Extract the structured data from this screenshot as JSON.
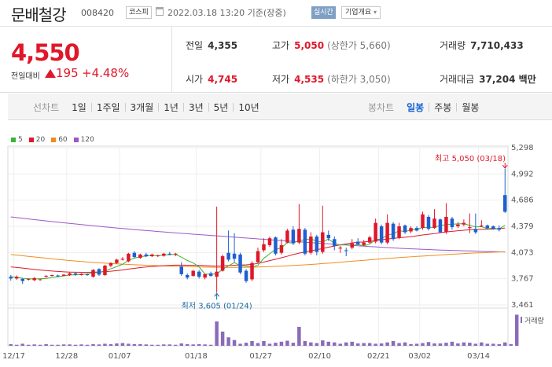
{
  "header": {
    "stock_name": "문배철강",
    "stock_code": "008420",
    "market": "코스피",
    "datetime": "2022.03.18 13:20 기준(장중)",
    "live_label": "실시간",
    "corp_label": "기업개요"
  },
  "price": {
    "current": "4,550",
    "change_label": "전일대비",
    "change": "195",
    "change_pct": "+4.48%"
  },
  "stats": {
    "prev_close_label": "전일",
    "prev_close": "4,355",
    "open_label": "시가",
    "open": "4,745",
    "high_label": "고가",
    "high": "5,050",
    "high_limit": "(상한가 5,660)",
    "low_label": "저가",
    "low": "4,535",
    "low_limit": "(하한가 3,050)",
    "volume_label": "거래량",
    "volume": "7,710,433",
    "amount_label": "거래대금",
    "amount": "37,204 백만"
  },
  "tabs": {
    "line_label": "선차트",
    "line_periods": [
      "1일",
      "1주일",
      "3개월",
      "1년",
      "3년",
      "5년",
      "10년"
    ],
    "candle_label": "봉차트",
    "candle_periods": [
      "일봉",
      "주봉",
      "월봉"
    ],
    "active_candle": "일봉"
  },
  "colors": {
    "up": "#e0172a",
    "down": "#1f5fd1",
    "ma5": "#3cb435",
    "ma20": "#e0172a",
    "ma60": "#f08c1e",
    "ma120": "#9b59c7",
    "volume": "#8a6bb8"
  },
  "chart_data": {
    "type": "candlestick",
    "y_ticks": [
      "5,298",
      "4,992",
      "4,686",
      "4,379",
      "4,073",
      "3,767",
      "3,461"
    ],
    "ylim": [
      3461,
      5298
    ],
    "x_ticks": [
      "12/17",
      "12/28",
      "01/07",
      "01/18",
      "01/27",
      "02/10",
      "02/21",
      "03/02",
      "03/14"
    ],
    "legend": [
      "5",
      "20",
      "60",
      "120"
    ],
    "high_annotation": "최고 5,050 (03/18)",
    "low_annotation": "최저 3,605 (01/24)",
    "volume_label": "거래량",
    "candles": [
      {
        "o": 3790,
        "c": 3770,
        "h": 3810,
        "l": 3745
      },
      {
        "o": 3770,
        "c": 3790,
        "h": 3805,
        "l": 3755
      },
      {
        "o": 3765,
        "c": 3740,
        "h": 3775,
        "l": 3705
      },
      {
        "o": 3760,
        "c": 3765,
        "h": 3770,
        "l": 3745
      },
      {
        "o": 3750,
        "c": 3775,
        "h": 3785,
        "l": 3740
      },
      {
        "o": 3755,
        "c": 3760,
        "h": 3765,
        "l": 3745
      },
      {
        "o": 3790,
        "c": 3800,
        "h": 3810,
        "l": 3780
      },
      {
        "o": 3800,
        "c": 3810,
        "h": 3815,
        "l": 3795
      },
      {
        "o": 3805,
        "c": 3795,
        "h": 3815,
        "l": 3785
      },
      {
        "o": 3800,
        "c": 3815,
        "h": 3820,
        "l": 3795
      },
      {
        "o": 3810,
        "c": 3830,
        "h": 3840,
        "l": 3800
      },
      {
        "o": 3830,
        "c": 3815,
        "h": 3840,
        "l": 3800
      },
      {
        "o": 3810,
        "c": 3825,
        "h": 3830,
        "l": 3805
      },
      {
        "o": 3820,
        "c": 3810,
        "h": 3830,
        "l": 3800
      },
      {
        "o": 3790,
        "c": 3870,
        "h": 3880,
        "l": 3780
      },
      {
        "o": 3880,
        "c": 3815,
        "h": 3890,
        "l": 3800
      },
      {
        "o": 3810,
        "c": 3920,
        "h": 3930,
        "l": 3800
      },
      {
        "o": 3920,
        "c": 3950,
        "h": 3960,
        "l": 3900
      },
      {
        "o": 3950,
        "c": 3990,
        "h": 4000,
        "l": 3940
      },
      {
        "o": 3990,
        "c": 4000,
        "h": 4020,
        "l": 3980
      },
      {
        "o": 3970,
        "c": 4060,
        "h": 4070,
        "l": 3960
      },
      {
        "o": 4070,
        "c": 4020,
        "h": 4090,
        "l": 4010
      },
      {
        "o": 4010,
        "c": 4050,
        "h": 4060,
        "l": 4000
      },
      {
        "o": 4050,
        "c": 4030,
        "h": 4070,
        "l": 4020
      },
      {
        "o": 4030,
        "c": 4050,
        "h": 4060,
        "l": 4020
      },
      {
        "o": 4030,
        "c": 4040,
        "h": 4050,
        "l": 4020
      },
      {
        "o": 4035,
        "c": 4060,
        "h": 4070,
        "l": 4025
      },
      {
        "o": 4060,
        "c": 4050,
        "h": 4080,
        "l": 4040
      },
      {
        "o": 4050,
        "c": 4060,
        "h": 4070,
        "l": 4030
      },
      {
        "o": 3910,
        "c": 3820,
        "h": 3960,
        "l": 3800
      },
      {
        "o": 3810,
        "c": 3780,
        "h": 3830,
        "l": 3760
      },
      {
        "o": 3800,
        "c": 3860,
        "h": 3870,
        "l": 3790
      },
      {
        "o": 3850,
        "c": 3790,
        "h": 3870,
        "l": 3770
      },
      {
        "o": 3780,
        "c": 3820,
        "h": 3830,
        "l": 3760
      },
      {
        "o": 3830,
        "c": 3800,
        "h": 3850,
        "l": 3790
      },
      {
        "o": 3790,
        "c": 3850,
        "h": 4610,
        "l": 3605
      },
      {
        "o": 3860,
        "c": 4030,
        "h": 4050,
        "l": 3850
      },
      {
        "o": 4070,
        "c": 3990,
        "h": 4330,
        "l": 3970
      },
      {
        "o": 4060,
        "c": 4000,
        "h": 4300,
        "l": 3960
      },
      {
        "o": 4050,
        "c": 3840,
        "h": 4070,
        "l": 3820
      },
      {
        "o": 3860,
        "c": 3740,
        "h": 3880,
        "l": 3720
      },
      {
        "o": 3760,
        "c": 3950,
        "h": 3970,
        "l": 3740
      },
      {
        "o": 3960,
        "c": 4090,
        "h": 4130,
        "l": 3950
      },
      {
        "o": 4100,
        "c": 4170,
        "h": 4240,
        "l": 4080
      },
      {
        "o": 4160,
        "c": 4240,
        "h": 4260,
        "l": 4140
      },
      {
        "o": 4250,
        "c": 4060,
        "h": 4260,
        "l": 4040
      },
      {
        "o": 4070,
        "c": 4160,
        "h": 4230,
        "l": 4050
      },
      {
        "o": 4190,
        "c": 4330,
        "h": 4350,
        "l": 4180
      },
      {
        "o": 4340,
        "c": 4180,
        "h": 4380,
        "l": 4160
      },
      {
        "o": 4190,
        "c": 4350,
        "h": 4640,
        "l": 4170
      },
      {
        "o": 4340,
        "c": 4060,
        "h": 4360,
        "l": 4040
      },
      {
        "o": 4070,
        "c": 4260,
        "h": 4310,
        "l": 4050
      },
      {
        "o": 4260,
        "c": 4080,
        "h": 4280,
        "l": 4040
      },
      {
        "o": 4080,
        "c": 4310,
        "h": 4620,
        "l": 4060
      },
      {
        "o": 4280,
        "c": 4240,
        "h": 4330,
        "l": 4210
      },
      {
        "o": 4230,
        "c": 4150,
        "h": 4260,
        "l": 4100
      },
      {
        "o": 4120,
        "c": 4130,
        "h": 4150,
        "l": 4070
      },
      {
        "o": 4100,
        "c": 4090,
        "h": 4130,
        "l": 4030
      },
      {
        "o": 4130,
        "c": 4180,
        "h": 4230,
        "l": 4110
      },
      {
        "o": 4200,
        "c": 4170,
        "h": 4240,
        "l": 4160
      },
      {
        "o": 4160,
        "c": 4190,
        "h": 4220,
        "l": 4150
      },
      {
        "o": 4190,
        "c": 4250,
        "h": 4270,
        "l": 4180
      },
      {
        "o": 4200,
        "c": 4420,
        "h": 4470,
        "l": 4180
      },
      {
        "o": 4380,
        "c": 4190,
        "h": 4400,
        "l": 4170
      },
      {
        "o": 4190,
        "c": 4420,
        "h": 4520,
        "l": 4170
      },
      {
        "o": 4410,
        "c": 4230,
        "h": 4430,
        "l": 4210
      },
      {
        "o": 4250,
        "c": 4380,
        "h": 4420,
        "l": 4230
      },
      {
        "o": 4390,
        "c": 4310,
        "h": 4400,
        "l": 4290
      },
      {
        "o": 4320,
        "c": 4360,
        "h": 4380,
        "l": 4300
      },
      {
        "o": 4360,
        "c": 4330,
        "h": 4380,
        "l": 4320
      },
      {
        "o": 4360,
        "c": 4520,
        "h": 4550,
        "l": 4340
      },
      {
        "o": 4490,
        "c": 4350,
        "h": 4510,
        "l": 4330
      },
      {
        "o": 4360,
        "c": 4470,
        "h": 4580,
        "l": 4350
      },
      {
        "o": 4460,
        "c": 4310,
        "h": 4470,
        "l": 4300
      },
      {
        "o": 4310,
        "c": 4490,
        "h": 4650,
        "l": 4290
      },
      {
        "o": 4470,
        "c": 4370,
        "h": 4490,
        "l": 4340
      },
      {
        "o": 4380,
        "c": 4400,
        "h": 4430,
        "l": 4360
      },
      {
        "o": 4400,
        "c": 4420,
        "h": 4460,
        "l": 4380
      },
      {
        "o": 4360,
        "c": 4370,
        "h": 4530,
        "l": 4300
      },
      {
        "o": 4350,
        "c": 4310,
        "h": 4530,
        "l": 4290
      },
      {
        "o": 4390,
        "c": 4390,
        "h": 4450,
        "l": 4370
      },
      {
        "o": 4390,
        "c": 4360,
        "h": 4400,
        "l": 4340
      },
      {
        "o": 4380,
        "c": 4350,
        "h": 4390,
        "l": 4340
      },
      {
        "o": 4360,
        "c": 4340,
        "h": 4390,
        "l": 4320
      },
      {
        "o": 4745,
        "c": 4550,
        "h": 5050,
        "l": 4535
      }
    ],
    "ma5": [
      3790,
      3785,
      3772,
      3768,
      3764,
      3768,
      3770,
      3782,
      3790,
      3801,
      3810,
      3813,
      3818,
      3821,
      3836,
      3840,
      3858,
      3883,
      3909,
      3936,
      3983,
      4006,
      4026,
      4032,
      4042,
      4034,
      4046,
      4048,
      4052,
      4020,
      3981,
      3952,
      3906,
      3822,
      3820,
      3824,
      3876,
      3918,
      3955,
      3920,
      3916,
      3903,
      3924,
      4006,
      4058,
      4112,
      4128,
      4190,
      4185,
      4212,
      4224,
      4232,
      4206,
      4196,
      4232,
      4180,
      4160,
      4165,
      4158,
      4166,
      4150,
      4172,
      4225,
      4232,
      4279,
      4291,
      4330,
      4317,
      4339,
      4344,
      4366,
      4367,
      4369,
      4390,
      4399,
      4404,
      4408,
      4411,
      4391,
      4373,
      4376,
      4352,
      4358,
      4350,
      4390
    ],
    "ma20": [
      3905,
      3898,
      3891,
      3884,
      3876,
      3869,
      3863,
      3857,
      3852,
      3848,
      3845,
      3843,
      3842,
      3842,
      3843,
      3846,
      3850,
      3855,
      3862,
      3870,
      3880,
      3888,
      3897,
      3904,
      3910,
      3914,
      3919,
      3922,
      3926,
      3926,
      3925,
      3925,
      3924,
      3920,
      3917,
      3915,
      3918,
      3921,
      3925,
      3927,
      3929,
      3935,
      3946,
      3962,
      3979,
      3995,
      4012,
      4030,
      4050,
      4066,
      4080,
      4094,
      4106,
      4120,
      4136,
      4149,
      4163,
      4174,
      4185,
      4193,
      4197,
      4204,
      4213,
      4222,
      4231,
      4238,
      4246,
      4252,
      4259,
      4268,
      4278,
      4286,
      4294,
      4305,
      4314,
      4321,
      4328,
      4334,
      4340,
      4342,
      4344,
      4346,
      4348,
      4352,
      4360
    ],
    "ma60": [
      4050,
      4043,
      4036,
      4028,
      4021,
      4014,
      4007,
      4000,
      3993,
      3987,
      3980,
      3974,
      3969,
      3963,
      3958,
      3953,
      3949,
      3945,
      3941,
      3937,
      3934,
      3931,
      3928,
      3925,
      3922,
      3919,
      3917,
      3915,
      3913,
      3911,
      3909,
      3907,
      3905,
      3903,
      3902,
      3901,
      3900,
      3900,
      3900,
      3900,
      3901,
      3902,
      3904,
      3906,
      3909,
      3912,
      3915,
      3918,
      3922,
      3926,
      3930,
      3934,
      3939,
      3944,
      3949,
      3954,
      3960,
      3966,
      3972,
      3977,
      3982,
      3988,
      3994,
      3999,
      4004,
      4009,
      4014,
      4019,
      4023,
      4028,
      4032,
      4036,
      4040,
      4045,
      4049,
      4053,
      4057,
      4061,
      4065,
      4068,
      4071,
      4074,
      4077,
      4080,
      4083
    ],
    "ma120": [
      4490,
      4482,
      4474,
      4466,
      4458,
      4451,
      4443,
      4436,
      4428,
      4421,
      4414,
      4407,
      4400,
      4393,
      4386,
      4379,
      4373,
      4367,
      4360,
      4354,
      4348,
      4342,
      4336,
      4330,
      4325,
      4319,
      4314,
      4308,
      4303,
      4298,
      4293,
      4288,
      4283,
      4278,
      4273,
      4268,
      4263,
      4258,
      4253,
      4248,
      4243,
      4238,
      4233,
      4228,
      4223,
      4218,
      4213,
      4208,
      4204,
      4199,
      4194,
      4189,
      4184,
      4180,
      4175,
      4170,
      4165,
      4161,
      4156,
      4152,
      4147,
      4143,
      4139,
      4135,
      4131,
      4127,
      4123,
      4120,
      4117,
      4114,
      4111,
      4108,
      4105,
      4102,
      4100,
      4098,
      4096,
      4094,
      4092,
      4090,
      4088,
      4086,
      4084,
      4082,
      4080
    ],
    "volume": [
      0.05,
      0.03,
      0.06,
      0.03,
      0.04,
      0.03,
      0.05,
      0.03,
      0.03,
      0.04,
      0.04,
      0.03,
      0.04,
      0.03,
      0.05,
      0.04,
      0.06,
      0.05,
      0.07,
      0.08,
      0.06,
      0.05,
      0.05,
      0.04,
      0.03,
      0.03,
      0.04,
      0.04,
      0.03,
      0.07,
      0.05,
      0.04,
      0.05,
      0.04,
      0.03,
      0.72,
      0.42,
      0.25,
      0.17,
      0.06,
      0.09,
      0.14,
      0.08,
      0.14,
      0.06,
      0.09,
      0.12,
      0.15,
      0.09,
      0.56,
      0.14,
      0.1,
      0.08,
      0.16,
      0.12,
      0.1,
      0.06,
      0.1,
      0.12,
      0.07,
      0.08,
      0.08,
      0.06,
      0.07,
      0.1,
      0.14,
      0.08,
      0.1,
      0.05,
      0.06,
      0.08,
      0.11,
      0.07,
      0.07,
      0.09,
      0.12,
      0.07,
      0.1,
      0.09,
      0.06,
      0.1,
      0.06,
      0.06,
      0.05,
      0.1,
      0.05,
      0.92
    ]
  }
}
